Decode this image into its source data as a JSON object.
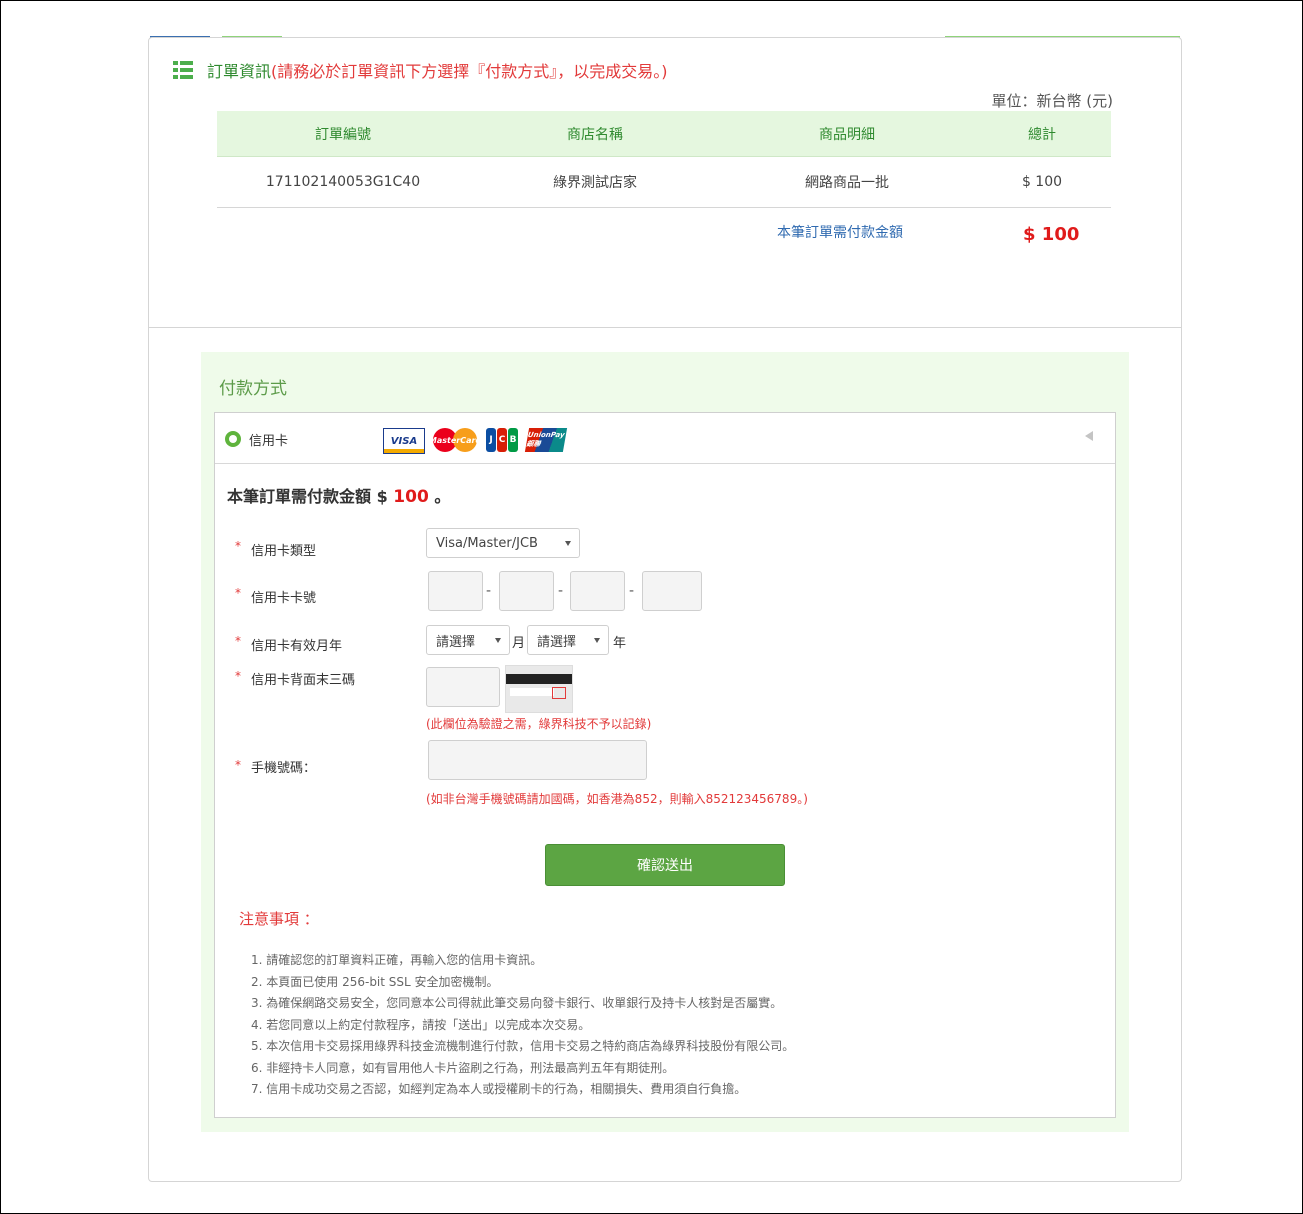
{
  "order": {
    "title": "訂單資訊",
    "note": "(請務必於訂單資訊下方選擇『付款方式』，以完成交易。)",
    "unit": "單位：新台幣 (元)",
    "columns": [
      "訂單編號",
      "商店名稱",
      "商品明細",
      "總計"
    ],
    "rows": [
      [
        "171102140053G1C40",
        "綠界測試店家",
        "網路商品一批",
        "$ 100"
      ]
    ],
    "total_label": "本筆訂單需付款金額",
    "total_amount": "$ 100"
  },
  "payment": {
    "title": "付款方式",
    "method_label": "信用卡",
    "logos": {
      "visa": "VISA",
      "mastercard": "MasterCard",
      "jcb": [
        "J",
        "C",
        "B"
      ],
      "unionpay": "UnionPay 銀聯"
    },
    "amount_prefix": "本筆訂單需付款金額 $ ",
    "amount_value": "100",
    "amount_suffix": " 。",
    "required_mark": "*",
    "fields": {
      "card_type_label": "信用卡類型",
      "card_type_value": "Visa/Master/JCB",
      "card_number_label": "信用卡卡號",
      "card_number_dash": "-",
      "expiry_label": "信用卡有效月年",
      "month_value": "請選擇",
      "month_unit": "月",
      "year_value": "請選擇",
      "year_unit": "年",
      "cvv_label": "信用卡背面末三碼",
      "cvv_hint": "(此欄位為驗證之需，綠界科技不予以記錄)",
      "phone_label": "手機號碼：",
      "phone_hint": "(如非台灣手機號碼請加國碼，如香港為852，則輸入852123456789。)"
    },
    "submit_label": "確認送出",
    "notes_title": "注意事項 ：",
    "notes": [
      "1. 請確認您的訂單資料正確，再輸入您的信用卡資訊。",
      "2. 本頁面已使用 256-bit SSL 安全加密機制。",
      "3. 為確保網路交易安全，您同意本公司得就此筆交易向發卡銀行、收單銀行及持卡人核對是否屬實。",
      "4. 若您同意以上約定付款程序，請按「送出」以完成本次交易。",
      "5. 本次信用卡交易採用綠界科技金流機制進行付款，信用卡交易之特約商店為綠界科技股份有限公司。",
      "6. 非經持卡人同意，如有冒用他人卡片盜刷之行為，刑法最高判五年有期徒刑。",
      "7. 信用卡成功交易之否認，如經判定為本人或授權刷卡的行為，相關損失、費用須自行負擔。"
    ]
  }
}
